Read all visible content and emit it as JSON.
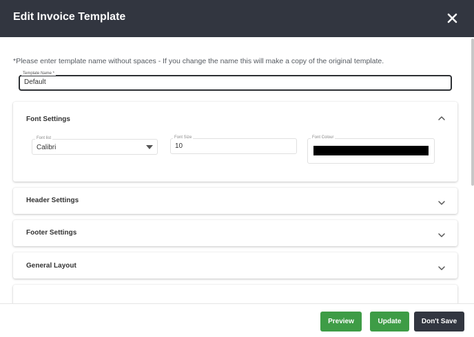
{
  "header": {
    "title": "Edit Invoice Template"
  },
  "hint": "*Please enter template name without spaces - If you change the name this will make a copy of the original template.",
  "template_name": {
    "label": "Template Name *",
    "value": "Default"
  },
  "font_settings": {
    "title": "Font Settings",
    "font_list": {
      "label": "Font list",
      "value": "Calibri"
    },
    "font_size": {
      "label": "Font Size",
      "value": "10"
    },
    "font_colour": {
      "label": "Font Colour",
      "value": "#000000"
    }
  },
  "sections": {
    "header_settings": "Header Settings",
    "footer_settings": "Footer Settings",
    "general_layout": "General Layout"
  },
  "footer": {
    "preview": "Preview",
    "update": "Update",
    "dont_save": "Don't Save"
  },
  "colors": {
    "header_bg": "#323640",
    "green_button": "#3e9c46",
    "dark_button": "#323640"
  }
}
